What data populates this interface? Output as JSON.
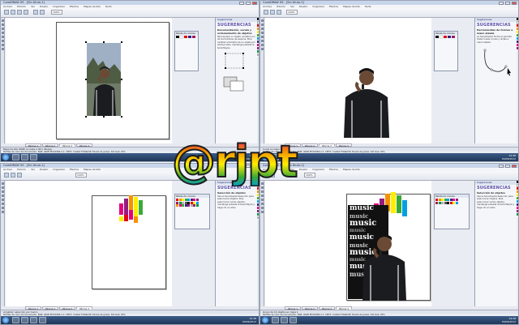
{
  "app": {
    "title": "CorelDRAW X5 - [Sin titulo-1]",
    "menu": [
      "Archivo",
      "Edición",
      "Ver",
      "Diseño",
      "Organizar",
      "Efectos",
      "Mapas de bits",
      "Texto",
      "Tabla",
      "Herramientas",
      "Ventana",
      "Ayuda"
    ],
    "zoom": "100%"
  },
  "page_tabs": [
    "Página 1",
    "Página 2",
    "Página 3",
    "Página 4"
  ],
  "active_tab": "Página 4",
  "docker": {
    "heading": "Sugerencias",
    "title": "SUGERENCIAS",
    "q1_subtitle": "Documentación, escala y ordenamiento de objetos",
    "q2_subtitle": "Herramientas de formas a mano alzada",
    "q3_subtitle": "Selección de objetos",
    "q4_subtitle": "Selección de objetos",
    "q1_body": "Para escalar un objeto, arrastre uno de los tiradores de esquina. Para cambiar el tamaño de un objeto por ambos lados, mantenga pulsada la tecla Mayús.",
    "q2_body": "La herramienta Forma le permite trazar líneas curvas y rectas a mano alzada.",
    "q3_body": "Use la herramienta Selección para seleccionar objetos. Para seleccionar varios objetos, mantenga pulsada la tecla Mayús y haga clic en ellos.",
    "q4_body": "Use la herramienta Selección para seleccionar objetos. Para seleccionar varios objetos, mantenga pulsada la tecla Mayús y haga clic en ellos."
  },
  "object_manager": {
    "heading": "Paleta de colores"
  },
  "status": {
    "q1": "Mapa de bits (RGB) en Capa 1 80 x 96 ppp",
    "q2": "Curva en Capa 1",
    "q3": "Grupo de 14 objetos en Capa 1",
    "q4": "Grupo de 14 objetos en Capa 1",
    "doc_profile": "Perfiles de color del documento: RGB: sRGB IEC61966-2.1; CMYK: Coated FOGRA39; Escala de grises: Dot Gain 20%",
    "q3_hint": "Arrastrar: selección por marco"
  },
  "clock": {
    "time": "19:48",
    "date": "03/06/2012"
  },
  "music_text": [
    "music",
    "music",
    "music",
    "music",
    "music",
    "music",
    "music",
    "music",
    "music",
    "music"
  ],
  "logo": {
    "text": "@rjpt"
  },
  "colors": {
    "accent": "#5d4fa8",
    "palette": [
      "#000000",
      "#ffffff",
      "#e30613",
      "#f39200",
      "#ffed00",
      "#3aaa35",
      "#009fe3",
      "#312783",
      "#e6007e",
      "#a3195b",
      "#951b81",
      "#009640",
      "#b2b2b2",
      "#575756"
    ]
  }
}
